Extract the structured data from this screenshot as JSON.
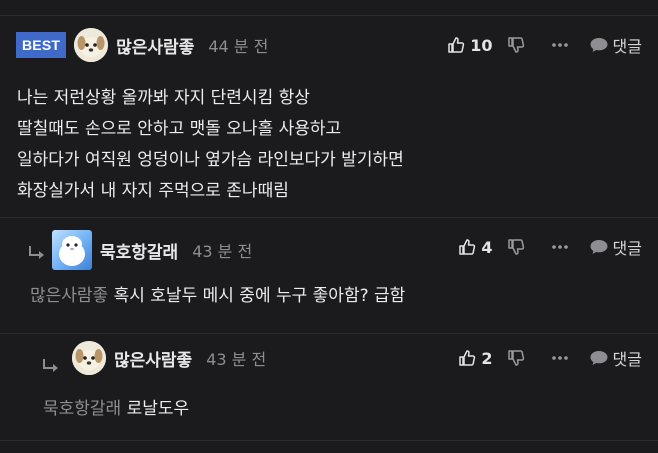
{
  "comments": [
    {
      "badge": "BEST",
      "nickname": "많은사람좋",
      "time": "44 분 전",
      "likes": "10",
      "reply_label": "댓글",
      "lines": [
        "나는 저런상황 올까봐 자지 단련시킴 항상",
        "딸칠때도 손으로 안하고 맷돌 오나홀 사용하고",
        "일하다가 여직원 엉덩이나 옆가슴 라인보다가 발기하면",
        "화장실가서 내 자지 주먹으로 존나때림"
      ]
    },
    {
      "nickname": "묵호항갈래",
      "time": "43 분 전",
      "likes": "4",
      "reply_label": "댓글",
      "mention": "많은사람좋",
      "text": "혹시 호날두 메시 중에 누구 좋아함? 급함"
    },
    {
      "nickname": "많은사람좋",
      "time": "43 분 전",
      "likes": "2",
      "reply_label": "댓글",
      "mention": "묵호항갈래",
      "text": "로날도우"
    }
  ],
  "icons": {
    "like": "thumbs-up-icon",
    "dislike": "thumbs-down-icon",
    "more": "more-dots-icon",
    "reply": "speech-bubble-icon",
    "reply_arrow": "reply-arrow-icon"
  },
  "colors": {
    "background": "#1b1b1d",
    "badge": "#3f6ac9",
    "divider": "#2c2c2f",
    "muted": "#8d8d92"
  }
}
